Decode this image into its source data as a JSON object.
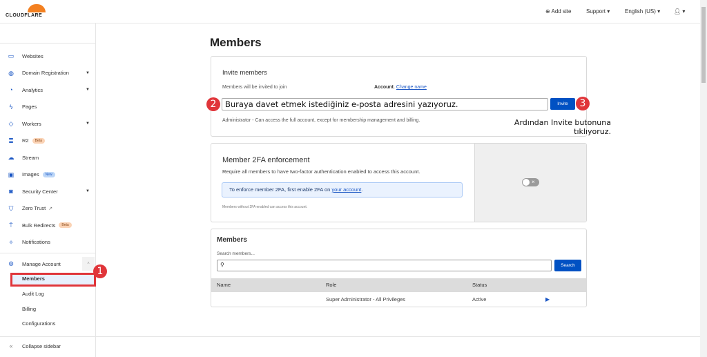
{
  "header": {
    "logo": "CLOUDFLARE",
    "add_site": "Add site",
    "support": "Support",
    "language": "English (US)"
  },
  "sidebar": {
    "items": [
      {
        "label": "Websites",
        "icon": "browser-icon"
      },
      {
        "label": "Domain Registration",
        "icon": "globe-icon",
        "caret": true
      },
      {
        "label": "Analytics",
        "icon": "chart-icon",
        "caret": true
      },
      {
        "label": "Pages",
        "icon": "lightning-icon"
      },
      {
        "label": "Workers",
        "icon": "workers-icon",
        "caret": true
      },
      {
        "label": "R2",
        "icon": "database-icon",
        "badge": "Beta"
      },
      {
        "label": "Stream",
        "icon": "cloud-play-icon"
      },
      {
        "label": "Images",
        "icon": "image-icon",
        "badge": "New"
      },
      {
        "label": "Security Center",
        "icon": "shield-icon",
        "caret": true
      },
      {
        "label": "Zero Trust",
        "icon": "zero-trust-icon"
      },
      {
        "label": "Bulk Redirects",
        "icon": "redirect-icon",
        "badge": "Beta"
      },
      {
        "label": "Notifications",
        "icon": "bell-icon"
      }
    ],
    "manage_account": "Manage Account",
    "sub_items": [
      "Members",
      "Audit Log",
      "Billing",
      "Configurations"
    ],
    "collapse": "Collapse sidebar"
  },
  "page": {
    "title": "Members"
  },
  "invite": {
    "title": "Invite members",
    "join_text": "Members will be invited to join",
    "account": "Account",
    "change_name": "Change name",
    "input_value": "Buraya davet etmek istediğiniz e-posta adresini yazıyoruz.",
    "invite_btn": "Invite",
    "role_text": "Administrator - Can access the full account, except for membership management and billing."
  },
  "twofa": {
    "title": "Member 2FA enforcement",
    "desc": "Require all members to have two-factor authentication enabled to access this account.",
    "notice_pre": "To enforce member 2FA, first enable 2FA on ",
    "notice_link": "your account",
    "notice_post": ".",
    "footnote": "Members without 2FA enabled can access this account.",
    "toggle_on": false
  },
  "members": {
    "title": "Members",
    "search_label": "Search members...",
    "search_placeholder": "",
    "search_btn": "Search",
    "columns": [
      "Name",
      "Role",
      "Status"
    ],
    "rows": [
      {
        "name": "",
        "role": "Super Administrator - All Privileges",
        "status": "Active"
      }
    ]
  },
  "annotations": {
    "step1": "1",
    "step2": "2",
    "step3": "3",
    "note": "Ardından Invite butonuna tıklıyoruz."
  },
  "colors": {
    "accent": "#0051c3",
    "brand": "#f38020",
    "annotation": "#e0353a"
  }
}
